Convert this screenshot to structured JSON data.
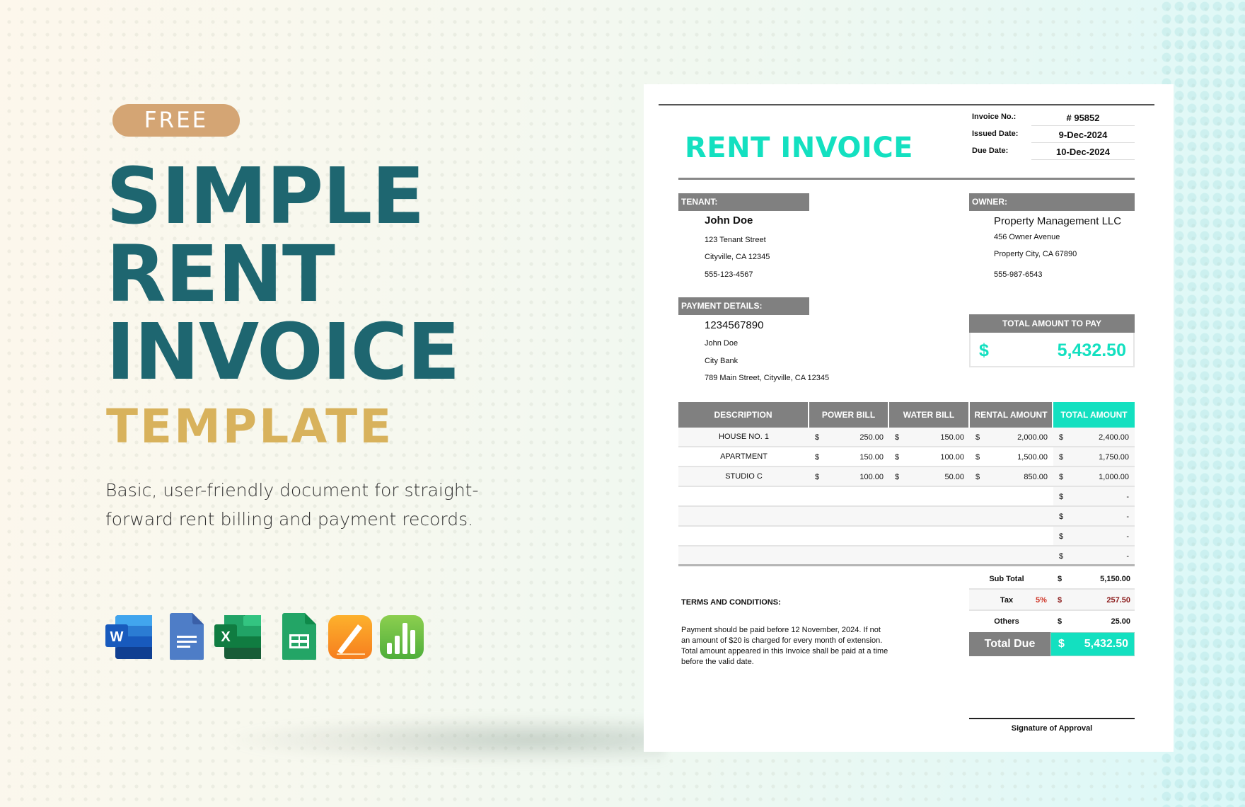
{
  "promo": {
    "badge": "FREE",
    "title_lines": [
      "SIMPLE",
      "RENT",
      "INVOICE"
    ],
    "subtitle": "TEMPLATE",
    "description": "Basic, user-friendly document for straight-forward rent billing and payment records.",
    "description_lines": [
      "Basic, user-friendly document for straight-",
      "forward rent billing and payment records."
    ],
    "apps": [
      {
        "name": "Microsoft Word",
        "icon": "word-icon",
        "letter": "W"
      },
      {
        "name": "Google Docs",
        "icon": "google-docs-icon"
      },
      {
        "name": "Microsoft Excel",
        "icon": "excel-icon",
        "letter": "X"
      },
      {
        "name": "Google Sheets",
        "icon": "google-sheets-icon"
      },
      {
        "name": "Apple Pages",
        "icon": "pages-icon"
      },
      {
        "name": "Apple Numbers",
        "icon": "numbers-icon"
      }
    ],
    "colors": {
      "badge": "#d4a574",
      "title": "#1e6670",
      "subtitle": "#d8b25c"
    }
  },
  "invoice": {
    "title": "RENT INVOICE",
    "meta": [
      {
        "label": "Invoice No.:",
        "value": "# 95852"
      },
      {
        "label": "Issued Date:",
        "value": "9-Dec-2024"
      },
      {
        "label": "Due Date:",
        "value": "10-Dec-2024"
      }
    ],
    "tenant": {
      "heading": "TENANT:",
      "name": "John Doe",
      "address1": "123 Tenant Street",
      "address2": "Cityville, CA 12345",
      "phone": "555-123-4567"
    },
    "owner": {
      "heading": "OWNER:",
      "name": "Property Management LLC",
      "address1": "456 Owner Avenue",
      "address2": "Property City, CA 67890",
      "phone": "555-987-6543"
    },
    "payment": {
      "heading": "PAYMENT DETAILS:",
      "account": "1234567890",
      "holder": "John Doe",
      "bank": "City Bank",
      "bank_address": "789 Main Street, Cityville, CA 12345"
    },
    "total_to_pay": {
      "heading": "TOTAL AMOUNT TO PAY",
      "currency": "$",
      "amount": "5,432.50"
    },
    "table": {
      "headers": [
        "DESCRIPTION",
        "POWER BILL",
        "WATER BILL",
        "RENTAL AMOUNT",
        "TOTAL AMOUNT"
      ],
      "currency": "$",
      "rows": [
        {
          "description": "HOUSE NO. 1",
          "power": "250.00",
          "water": "150.00",
          "rental": "2,000.00",
          "total": "2,400.00"
        },
        {
          "description": "APARTMENT",
          "power": "150.00",
          "water": "100.00",
          "rental": "1,500.00",
          "total": "1,750.00"
        },
        {
          "description": "STUDIO C",
          "power": "100.00",
          "water": "50.00",
          "rental": "850.00",
          "total": "1,000.00"
        },
        {
          "description": "",
          "power": "",
          "water": "",
          "rental": "",
          "total": "-"
        },
        {
          "description": "",
          "power": "",
          "water": "",
          "rental": "",
          "total": "-"
        },
        {
          "description": "",
          "power": "",
          "water": "",
          "rental": "",
          "total": "-"
        },
        {
          "description": "",
          "power": "",
          "water": "",
          "rental": "",
          "total": "-"
        }
      ]
    },
    "summary": {
      "subtotal_label": "Sub Total",
      "subtotal": "5,150.00",
      "tax_label": "Tax",
      "tax_rate": "5%",
      "tax": "257.50",
      "others_label": "Others",
      "others": "25.00",
      "total_due_label": "Total Due",
      "total_due": "5,432.50",
      "currency": "$"
    },
    "terms": {
      "heading": "TERMS AND CONDITIONS:",
      "text": "Payment should be paid before 12 November, 2024. If not an amount of $20 is charged for every month of extension. Total amount appeared in this Invoice shall be paid at a time before the valid date."
    },
    "signature_label": "Signature of Approval",
    "colors": {
      "accent": "#13e0c0",
      "header_gray": "#808080",
      "tax_red": "#8b1a1a",
      "tax_rate_red": "#d0382a"
    }
  }
}
